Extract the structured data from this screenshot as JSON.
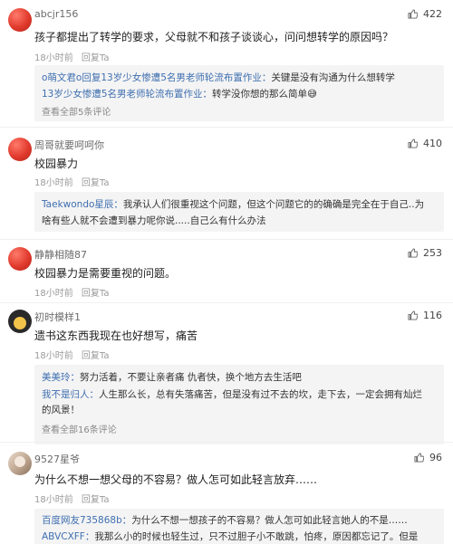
{
  "reply_label": "回复Ta",
  "comments": [
    {
      "user": "abcjr156",
      "likes": "422",
      "text": "孩子都提出了转学的要求，父母就不和孩子谈谈心，问问想转学的原因吗？",
      "time": "18小时前",
      "replies": [
        {
          "who": "o萌文君o回复13岁少女惨遭5名男老师轮流布置作业：",
          "text": "关键是没有沟通为什么想转学"
        },
        {
          "who": "13岁少女惨遭5名男老师轮流布置作业：",
          "text": "转学没你想的那么简单😅"
        }
      ],
      "more": "查看全部5条评论"
    },
    {
      "user": "周哥就要呵呵你",
      "likes": "410",
      "text": "校园暴力",
      "time": "18小时前",
      "replies": [
        {
          "who": "Taekwondo星辰：",
          "text": "我承认人们很重视这个问题，但这个问题它的的确确是完全在于自己..为"
        },
        {
          "who": "",
          "text": "啥有些人就不会遭到暴力呢你说.....自己么有什么办法"
        }
      ]
    },
    {
      "user": "静静相随87",
      "likes": "253",
      "text": "校园暴力是需要重视的问题。",
      "time": "18小时前"
    },
    {
      "user": "初时模样1",
      "likes": "116",
      "text": "遗书这东西我现在也好想写，痛苦",
      "time": "18小时前",
      "replies": [
        {
          "who": "美美玲：",
          "text": "努力活着，不要让亲者痛 仇者快，换个地方去生活吧"
        },
        {
          "who": "我不是归人：",
          "text": "人生那么长，总有失落痛苦，但是没有过不去的坎，走下去，一定会拥有灿烂"
        },
        {
          "who": "",
          "text": "的风景！"
        }
      ],
      "more": "查看全部16条评论"
    },
    {
      "user": "9527星爷",
      "likes": "96",
      "text": "为什么不想一想父母的不容易？做人怎可如此轻言放弃……",
      "time": "18小时前",
      "replies": [
        {
          "who": "百度网友735868b：",
          "text": "为什么不想一想孩子的不容易？做人怎可如此轻言她人的不是……"
        },
        {
          "who": "ABVCXFF：",
          "text": "我那么小的时候也轻生过，只不过胆子小不敢跳，怕疼，原因都忘记了。但是"
        }
      ]
    }
  ]
}
